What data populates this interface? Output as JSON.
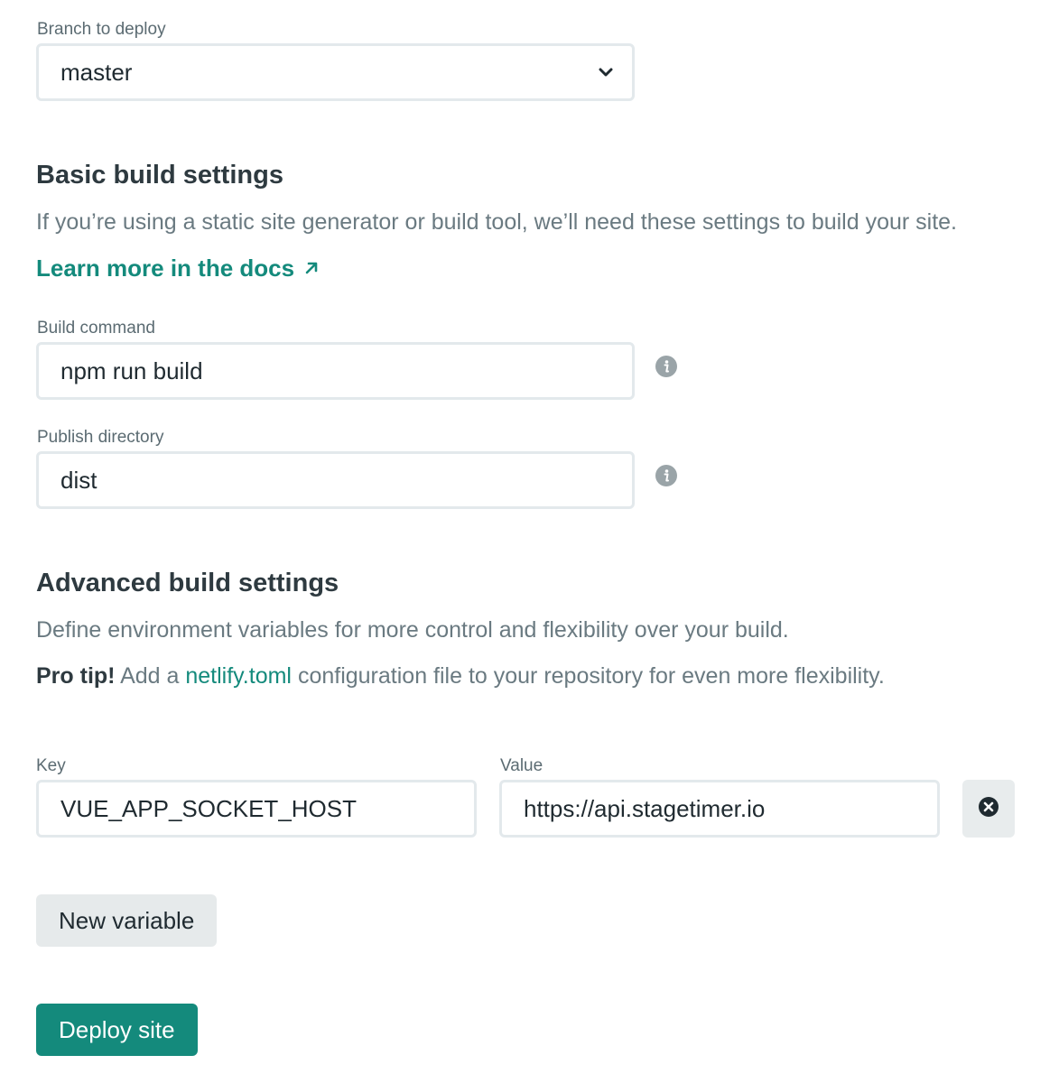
{
  "branch": {
    "label": "Branch to deploy",
    "selected": "master"
  },
  "basic": {
    "title": "Basic build settings",
    "description": "If you’re using a static site generator or build tool, we’ll need these settings to build your site.",
    "docs_link": "Learn more in the docs",
    "docs_link_icon": "external-arrow-icon",
    "build_command": {
      "label": "Build command",
      "value": "npm run build"
    },
    "publish_directory": {
      "label": "Publish directory",
      "value": "dist"
    }
  },
  "advanced": {
    "title": "Advanced build settings",
    "description": "Define environment variables for more control and flexibility over your build.",
    "tip": {
      "prefix": "Pro tip!",
      "before_link": " Add a ",
      "link": "netlify.toml",
      "after_link": " configuration file to your repository for even more flexibility."
    },
    "variables": {
      "key_label": "Key",
      "value_label": "Value",
      "rows": [
        {
          "key": "VUE_APP_SOCKET_HOST",
          "value": "https://api.stagetimer.io"
        }
      ]
    },
    "new_variable_button": "New variable"
  },
  "deploy_button": "Deploy site",
  "colors": {
    "accent": "#148a7c",
    "heading": "#2e3a40",
    "muted": "#6a7a81",
    "border": "#e3e9ec"
  }
}
